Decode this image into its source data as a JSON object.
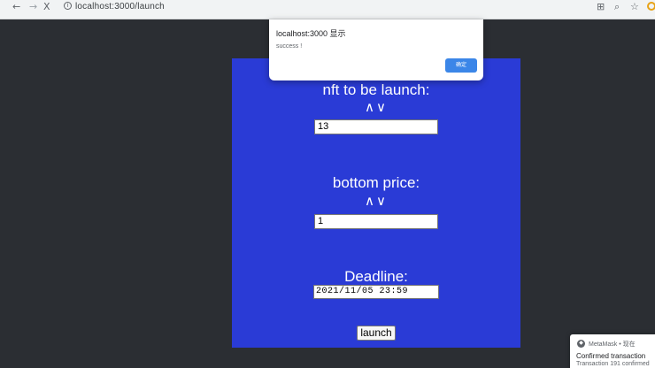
{
  "browser": {
    "nav_back": "←",
    "nav_forward": "→",
    "nav_reload": "X",
    "url": "localhost:3000/launch",
    "info_icon": "i",
    "toolbar_icons": [
      "translate-icon",
      "zoom-icon",
      "star-icon",
      "extension-icon"
    ]
  },
  "dialog": {
    "title": "localhost:3000 显示",
    "message": "success !",
    "ok_label": "确定",
    "ok_color": "#3b86e8"
  },
  "panel": {
    "background": "#2a3bd6",
    "nft_heading": "nft to be launch:",
    "nft_value": "13",
    "price_heading": "bottom price:",
    "price_value": "1",
    "deadline_heading": "Deadline:",
    "deadline_value": "2021/11/05 23:59",
    "chevron_up": "∧",
    "chevron_down": "∨",
    "launch_label": "launch"
  },
  "toast": {
    "source": "MetaMask • 现在",
    "title": "Confirmed transaction",
    "body": "Transaction 191 confirmed"
  }
}
